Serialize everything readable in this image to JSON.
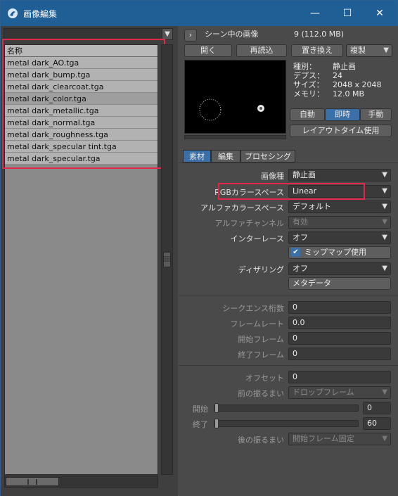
{
  "window": {
    "title": "画像編集",
    "app_icon": "lightwave-icon",
    "minimize": "—",
    "maximize": "☐",
    "close": "✕"
  },
  "colors": {
    "titlebar": "#1f5f96",
    "highlight_box": "#e0284a",
    "active_button": "#3a6fa8"
  },
  "left": {
    "list_header": "名称",
    "files": [
      "metal dark_AO.tga",
      "metal dark_bump.tga",
      "metal dark_clearcoat.tga",
      "metal dark_color.tga",
      "metal dark_metallic.tga",
      "metal dark_normal.tga",
      "metal dark_roughness.tga",
      "metal dark_specular tint.tga",
      "metal dark_specular.tga"
    ],
    "selected_file": "metal dark_color.tga"
  },
  "right": {
    "scene_label": "シーン中の画像",
    "scene_count": "9 (112.0 MB)",
    "btn_open": "開く",
    "btn_reload": "再読込",
    "btn_replace": "置き換え",
    "btn_clone": "複製",
    "info": {
      "type_label": "種別：",
      "type_value": "静止画",
      "depth_label": "デプス：",
      "depth_value": "24",
      "size_label": "サイズ：",
      "size_value": "2048 x 2048",
      "memory_label": "メモリ：",
      "memory_value": "12.0 MB"
    },
    "load_auto": "自動",
    "load_immediate": "即時",
    "load_manual": "手動",
    "btn_layout_time": "レイアウトタイム使用",
    "tabs": [
      "素材",
      "編集",
      "プロセシング"
    ],
    "props": {
      "image_type_label": "画像種",
      "image_type_value": "静止画",
      "rgb_cs_label": "RGBカラースペース",
      "rgb_cs_value": "Linear",
      "alpha_cs_label": "アルファカラースペース",
      "alpha_cs_value": "デフォルト",
      "alpha_ch_label": "アルファチャンネル",
      "alpha_ch_value": "有効",
      "interlace_label": "インターレース",
      "interlace_value": "オフ",
      "mipmap_label": "ミップマップ使用",
      "dither_label": "ディザリング",
      "dither_value": "オフ",
      "metadata_btn": "メタデータ"
    },
    "sequence": {
      "digits_label": "シークエンス桁数",
      "digits_value": "0",
      "framerate_label": "フレームレート",
      "framerate_value": "0.0",
      "start_label": "開始フレーム",
      "start_value": "0",
      "end_label": "終了フレーム",
      "end_value": "0"
    },
    "timing": {
      "offset_label": "オフセット",
      "offset_value": "0",
      "pre_label": "前の振るまい",
      "pre_value": "ドロップフレーム",
      "start_label": "開始",
      "start_value": "0",
      "end_label": "終了",
      "end_value": "60",
      "post_label": "後の振るまい",
      "post_value": "開始フレーム固定"
    }
  }
}
